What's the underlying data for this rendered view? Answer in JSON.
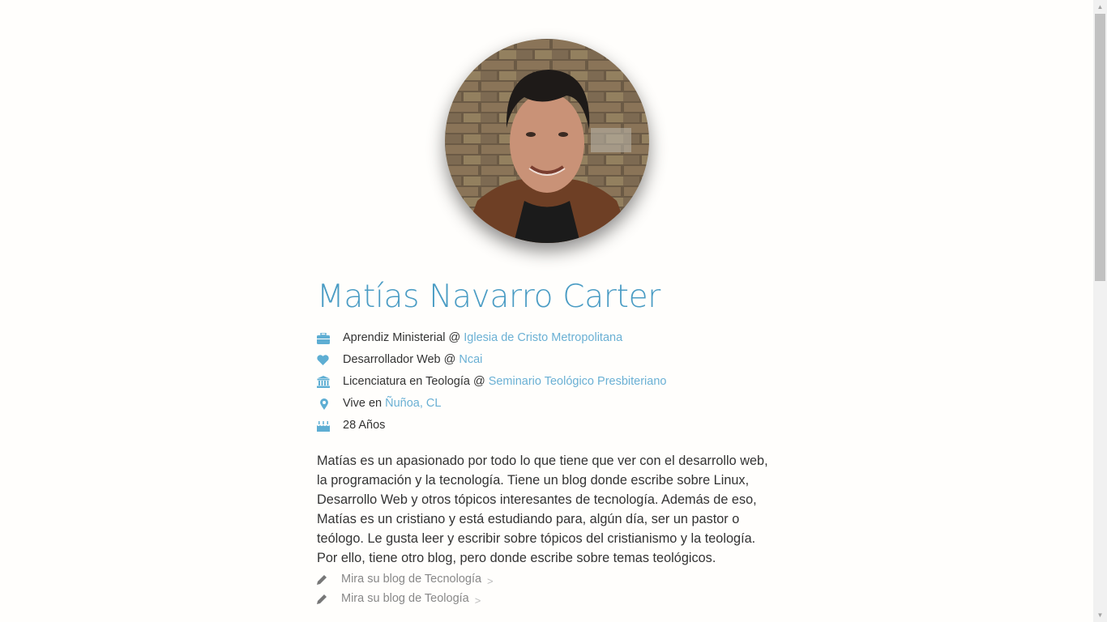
{
  "profile": {
    "name": "Matías Navarro Carter",
    "avatar_alt": "Matías Navarro Carter"
  },
  "facts": [
    {
      "icon": "briefcase-icon",
      "text": "Aprendiz Ministerial @",
      "link": "Iglesia de Cristo Metropolitana"
    },
    {
      "icon": "heart-icon",
      "text": "Desarrollador Web @",
      "link": "Ncai"
    },
    {
      "icon": "institution-icon",
      "text": "Licenciatura en Teología @",
      "link": "Seminario Teológico Presbiteriano"
    },
    {
      "icon": "map-marker-icon",
      "text": "Vive en",
      "link": "Ñuñoa, CL"
    },
    {
      "icon": "birthday-cake-icon",
      "text": "28 Años",
      "link": ""
    }
  ],
  "bio": "Matías es un apasionado por todo lo que tiene que ver con el desarrollo web, la programación y la tecnología. Tiene un blog donde escribe sobre Linux, Desarrollo Web y otros tópicos interesantes de tecnología. Además de eso, Matías es un cristiano y está estudiando para, algún día, ser un pastor o teólogo. Le gusta leer y escribir sobre tópicos del cristianismo y la teología. Por ello, tiene otro blog, pero donde escribe sobre temas teológicos.",
  "blogs": [
    {
      "label": "Mira su blog de Tecnología",
      "chevron": ">"
    },
    {
      "label": "Mira su blog de Teología",
      "chevron": ">"
    }
  ],
  "colors": {
    "accent": "#4a9cc4",
    "link": "#6ab0d4",
    "background": "#fffefc"
  }
}
